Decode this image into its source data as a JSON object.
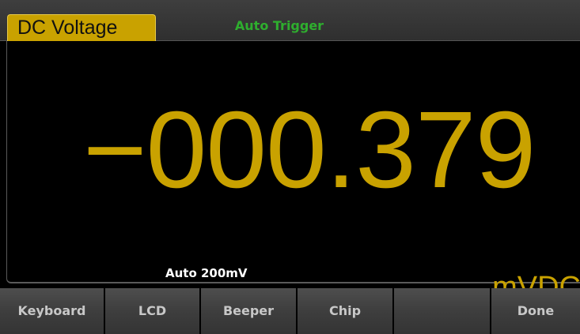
{
  "status_bar": {
    "mode": "DC Voltage",
    "trigger": "Auto Trigger"
  },
  "measurement": {
    "reading": "−000.379",
    "range": "Auto  200mV",
    "unit": "mVDC"
  },
  "softkeys": [
    {
      "label": "Keyboard"
    },
    {
      "label": "LCD"
    },
    {
      "label": "Beeper"
    },
    {
      "label": "Chip"
    },
    {
      "label": ""
    },
    {
      "label": "Done"
    }
  ],
  "colors": {
    "accent_yellow": "#c9a200",
    "trigger_green": "#2eae2e",
    "background": "#000000",
    "softkey_gray": "#3f3f3f"
  }
}
